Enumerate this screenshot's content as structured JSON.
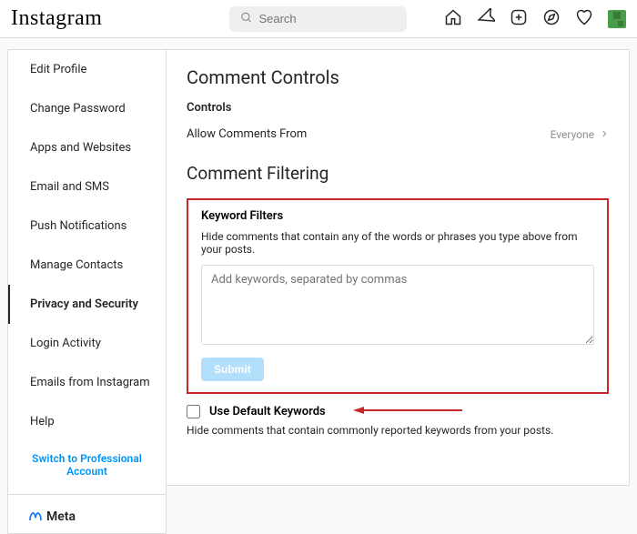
{
  "header": {
    "logo_text": "Instagram",
    "search_placeholder": "Search"
  },
  "sidebar": {
    "items": [
      {
        "label": "Edit Profile"
      },
      {
        "label": "Change Password"
      },
      {
        "label": "Apps and Websites"
      },
      {
        "label": "Email and SMS"
      },
      {
        "label": "Push Notifications"
      },
      {
        "label": "Manage Contacts"
      },
      {
        "label": "Privacy and Security"
      },
      {
        "label": "Login Activity"
      },
      {
        "label": "Emails from Instagram"
      },
      {
        "label": "Help"
      }
    ],
    "switch_link": "Switch to Professional Account",
    "meta_label": "Meta"
  },
  "content": {
    "title": "Comment Controls",
    "controls_heading": "Controls",
    "allow_comments_label": "Allow Comments From",
    "allow_comments_value": "Everyone",
    "filtering_heading": "Comment Filtering",
    "keyword": {
      "title": "Keyword Filters",
      "desc": "Hide comments that contain any of the words or phrases you type above from your posts.",
      "placeholder": "Add keywords, separated by commas",
      "submit_label": "Submit"
    },
    "default_keywords": {
      "label": "Use Default Keywords",
      "desc": "Hide comments that contain commonly reported keywords from your posts."
    }
  }
}
